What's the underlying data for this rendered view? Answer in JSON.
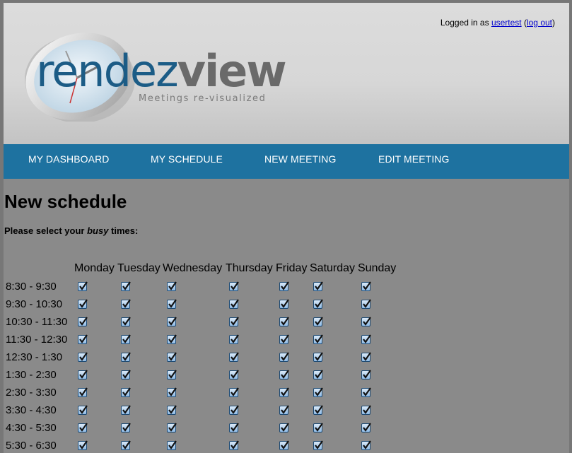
{
  "header": {
    "logo_part1": "rendez",
    "logo_part2": "view",
    "tagline": "Meetings re-visualized",
    "login_prefix": "Logged in as ",
    "username": "usertest",
    "logout_label": "log out"
  },
  "nav": {
    "items": [
      {
        "label": "MY DASHBOARD"
      },
      {
        "label": "MY SCHEDULE"
      },
      {
        "label": "NEW MEETING"
      },
      {
        "label": "EDIT MEETING"
      }
    ]
  },
  "page": {
    "title": "New schedule",
    "instruction_pre": "Please select your ",
    "instruction_em": "busy",
    "instruction_post": " times:"
  },
  "schedule": {
    "days": [
      "Monday",
      "Tuesday",
      "Wednesday",
      "Thursday",
      "Friday",
      "Saturday",
      "Sunday"
    ],
    "slots": [
      "8:30 - 9:30",
      "9:30 - 10:30",
      "10:30 - 11:30",
      "11:30 - 12:30",
      "12:30 - 1:30",
      "1:30 - 2:30",
      "2:30 - 3:30",
      "3:30 - 4:30",
      "4:30 - 5:30",
      "5:30 - 6:30"
    ],
    "all_checked": true
  },
  "colors": {
    "nav_bg": "#1e72a0",
    "logo_blue": "#1c5c86",
    "page_bg": "#8a8a8a"
  }
}
